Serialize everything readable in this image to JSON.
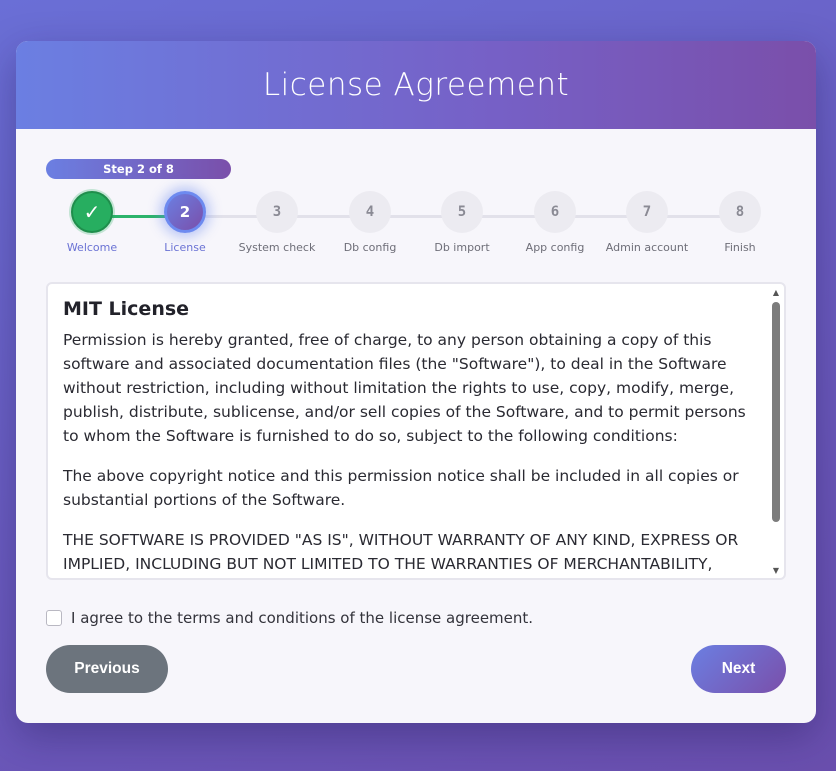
{
  "header": {
    "title": "License Agreement"
  },
  "progress": {
    "label": "Step 2 of 8",
    "current": 2,
    "total": 8
  },
  "steps": [
    {
      "number": "✓",
      "label": "Welcome",
      "state": "done"
    },
    {
      "number": "2",
      "label": "License",
      "state": "active"
    },
    {
      "number": "3",
      "label": "System check",
      "state": "pending"
    },
    {
      "number": "4",
      "label": "Db config",
      "state": "pending"
    },
    {
      "number": "5",
      "label": "Db import",
      "state": "pending"
    },
    {
      "number": "6",
      "label": "App config",
      "state": "pending"
    },
    {
      "number": "7",
      "label": "Admin account",
      "state": "pending"
    },
    {
      "number": "8",
      "label": "Finish",
      "state": "pending"
    }
  ],
  "license": {
    "heading": "MIT License",
    "paragraphs": [
      "Permission is hereby granted, free of charge, to any person obtaining a copy of this software and associated documentation files (the \"Software\"), to deal in the Software without restriction, including without limitation the rights to use, copy, modify, merge, publish, distribute, sublicense, and/or sell copies of the Software, and to permit persons to whom the Software is furnished to do so, subject to the following conditions:",
      "The above copyright notice and this permission notice shall be included in all copies or substantial portions of the Software.",
      "THE SOFTWARE IS PROVIDED \"AS IS\", WITHOUT WARRANTY OF ANY KIND, EXPRESS OR IMPLIED, INCLUDING BUT NOT LIMITED TO THE WARRANTIES OF MERCHANTABILITY, FITNESS FOR A"
    ],
    "scroll_up_icon": "▲",
    "scroll_down_icon": "▼"
  },
  "agreement": {
    "label": "I agree to the terms and conditions of the license agreement.",
    "checked": false
  },
  "buttons": {
    "previous": "Previous",
    "next": "Next"
  },
  "colors": {
    "accent_start": "#6b7fe2",
    "accent_end": "#7a4faa",
    "done_green": "#27ae60",
    "previous_gray": "#6c747d"
  }
}
